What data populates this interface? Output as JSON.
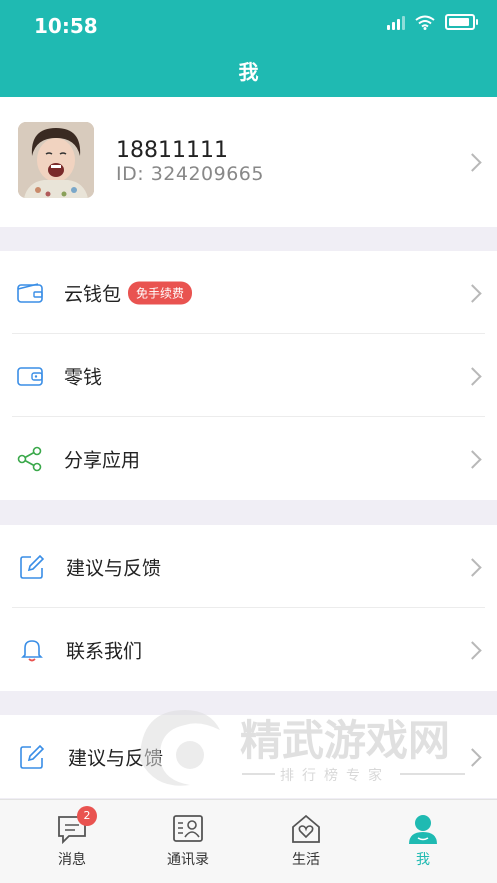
{
  "status_bar": {
    "time": "10:58"
  },
  "header": {
    "title": "我"
  },
  "profile": {
    "phone": "18811111",
    "id_label": "ID:",
    "id_value": "324209665"
  },
  "sections": [
    {
      "items": [
        {
          "label": "云钱包",
          "icon": "wallet-icon",
          "badge": "免手续费"
        },
        {
          "label": "零钱",
          "icon": "change-wallet-icon"
        },
        {
          "label": "分享应用",
          "icon": "share-icon"
        }
      ]
    },
    {
      "items": [
        {
          "label": "建议与反馈",
          "icon": "edit-icon"
        },
        {
          "label": "联系我们",
          "icon": "bell-icon"
        }
      ]
    },
    {
      "items": [
        {
          "label": "建议与反馈",
          "icon": "edit-icon"
        }
      ]
    }
  ],
  "watermark": {
    "text": "精武游戏网",
    "subtext": "排行榜专家"
  },
  "tabs": [
    {
      "label": "消息",
      "icon": "message-icon",
      "badge": "2"
    },
    {
      "label": "通讯录",
      "icon": "contacts-icon"
    },
    {
      "label": "生活",
      "icon": "life-home-icon"
    },
    {
      "label": "我",
      "icon": "me-icon",
      "active": true
    }
  ],
  "colors": {
    "accent": "#1fbab2",
    "badge": "#e95350",
    "icon_blue": "#3a8ee6",
    "icon_green": "#3aa84a"
  }
}
